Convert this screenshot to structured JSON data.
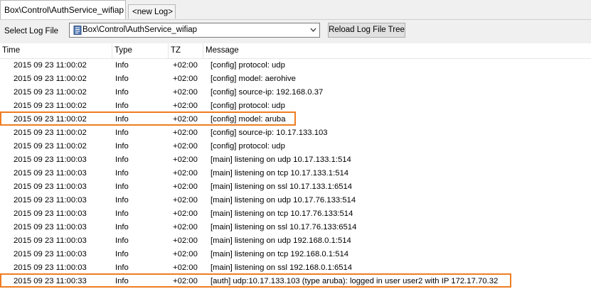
{
  "tabs": [
    {
      "label": "Box\\Control\\AuthService_wifiap"
    },
    {
      "label": "<new Log>"
    }
  ],
  "toolbar": {
    "select_label": "Select Log File",
    "log_file_value": "Box\\Control\\AuthService_wifiap",
    "reload_label": "Reload Log File Tree"
  },
  "columns": [
    "Time",
    "Type",
    "TZ",
    "Message"
  ],
  "rows": [
    {
      "time": "2015 09 23 11:00:02",
      "type": "Info",
      "tz": "+02:00",
      "message": "[config] protocol: udp"
    },
    {
      "time": "2015 09 23 11:00:02",
      "type": "Info",
      "tz": "+02:00",
      "message": "[config] model: aerohive"
    },
    {
      "time": "2015 09 23 11:00:02",
      "type": "Info",
      "tz": "+02:00",
      "message": "[config] source-ip: 192.168.0.37"
    },
    {
      "time": "2015 09 23 11:00:02",
      "type": "Info",
      "tz": "+02:00",
      "message": "[config] protocol: udp"
    },
    {
      "time": "2015 09 23 11:00:02",
      "type": "Info",
      "tz": "+02:00",
      "message": "[config] model: aruba"
    },
    {
      "time": "2015 09 23 11:00:02",
      "type": "Info",
      "tz": "+02:00",
      "message": "[config] source-ip: 10.17.133.103"
    },
    {
      "time": "2015 09 23 11:00:02",
      "type": "Info",
      "tz": "+02:00",
      "message": "[config] protocol: udp"
    },
    {
      "time": "2015 09 23 11:00:03",
      "type": "Info",
      "tz": "+02:00",
      "message": "[main] listening on udp 10.17.133.1:514"
    },
    {
      "time": "2015 09 23 11:00:03",
      "type": "Info",
      "tz": "+02:00",
      "message": "[main] listening on tcp 10.17.133.1:514"
    },
    {
      "time": "2015 09 23 11:00:03",
      "type": "Info",
      "tz": "+02:00",
      "message": "[main] listening on ssl 10.17.133.1:6514"
    },
    {
      "time": "2015 09 23 11:00:03",
      "type": "Info",
      "tz": "+02:00",
      "message": "[main] listening on udp 10.17.76.133:514"
    },
    {
      "time": "2015 09 23 11:00:03",
      "type": "Info",
      "tz": "+02:00",
      "message": "[main] listening on tcp 10.17.76.133:514"
    },
    {
      "time": "2015 09 23 11:00:03",
      "type": "Info",
      "tz": "+02:00",
      "message": "[main] listening on ssl 10.17.76.133:6514"
    },
    {
      "time": "2015 09 23 11:00:03",
      "type": "Info",
      "tz": "+02:00",
      "message": "[main] listening on udp 192.168.0.1:514"
    },
    {
      "time": "2015 09 23 11:00:03",
      "type": "Info",
      "tz": "+02:00",
      "message": "[main] listening on tcp 192.168.0.1:514"
    },
    {
      "time": "2015 09 23 11:00:03",
      "type": "Info",
      "tz": "+02:00",
      "message": "[main] listening on ssl 192.168.0.1:6514"
    },
    {
      "time": "2015 09 23 11:00:33",
      "type": "Info",
      "tz": "+02:00",
      "message": "[auth] udp:10.17.133.103 (type aruba): logged in user user2 with IP 172.17.70.32"
    }
  ],
  "highlight_color": "#ef7d22"
}
